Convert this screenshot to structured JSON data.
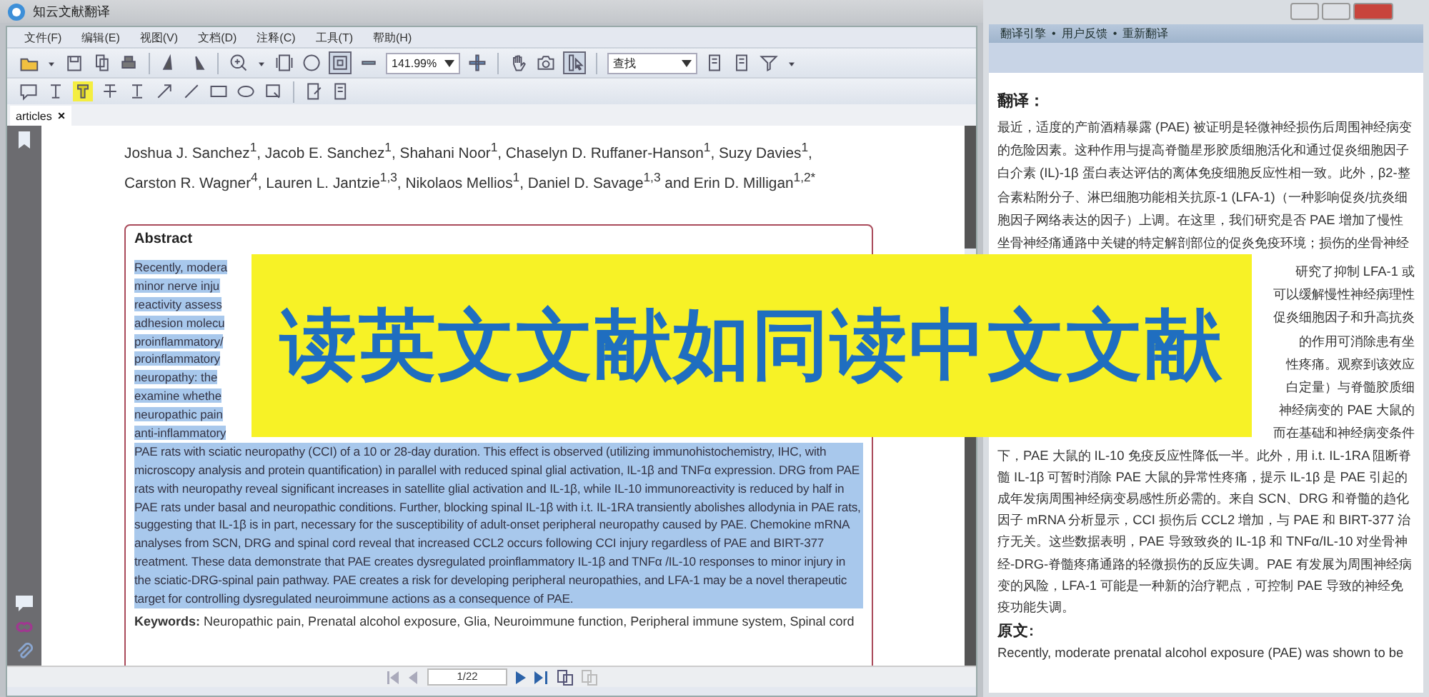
{
  "window": {
    "title": "知云文献翻译"
  },
  "menu": [
    "文件(F)",
    "编辑(E)",
    "视图(V)",
    "文档(D)",
    "注释(C)",
    "工具(T)",
    "帮助(H)"
  ],
  "toolbar": {
    "zoom": "141.99%",
    "search_mode": "查找"
  },
  "tabs": [
    {
      "label": "articles",
      "close": "×",
      "selected": true
    }
  ],
  "document": {
    "authors": [
      "Joshua J. Sanchez$^{1}$, Jacob E. Sanchez$^{1}$, Shahani Noor$^{1}$, Chaselyn D. Ruffaner-Hanson$^{1}$, Suzy Davies$^{1}$,",
      "Carston R. Wagner$^{4}$, Lauren L. Jantzie$^{1,3}$, Nikolaos Mellios$^{1}$, Daniel D. Savage$^{1,3}$ and Erin D. Milligan$^{1,2*}$"
    ],
    "abstract_title": "Abstract",
    "abstract": {
      "selected": true,
      "visible_line_starts": [
        "Recently, modera",
        "minor nerve inju",
        "reactivity assess",
        "adhesion molecu",
        "proinflammatory/",
        "proinflammatory",
        "neuropathy: the",
        "examine whethe",
        "neuropathic pain",
        "anti-inflammatory"
      ],
      "text": "PAE rats with sciatic neuropathy (CCI) of a 10 or 28-day duration. This effect is observed (utilizing immunohistochemistry, IHC, with microscopy analysis and protein quantification) in parallel with reduced spinal glial activation, IL-1β and TNFα expression. DRG from PAE rats with neuropathy reveal significant increases in satellite glial activation and IL-1β, while IL-10 immunoreactivity is reduced by half in PAE rats under basal and neuropathic conditions. Further, blocking spinal IL-1β with i.t. IL-1RA transiently abolishes allodynia in PAE rats, suggesting that IL-1β is in part, necessary for the susceptibility of adult-onset peripheral neuropathy caused by PAE. Chemokine mRNA analyses from SCN, DRG and spinal cord reveal that increased CCL2 occurs following CCI injury regardless of PAE and BIRT-377 treatment. These data demonstrate that PAE creates dysregulated proinflammatory IL-1β and TNFα /IL-10 responses to minor injury in the sciatic-DRG-spinal pain pathway. PAE creates a risk for developing peripheral neuropathies, and LFA-1 may be a novel therapeutic target for controlling dysregulated neuroimmune actions as a consequence of PAE."
    },
    "keywords": "**Keywords:** Neuropathic pain, Prenatal alcohol exposure, Glia, Neuroimmune function, Peripheral immune system, Spinal cord"
  },
  "page_nav": {
    "page": "1/22"
  },
  "banner": {
    "text": "读英文文献如同读中文文献"
  },
  "translation_panel": {
    "links": [
      "翻译引擎",
      "用户反馈",
      "重新翻译"
    ],
    "separator": "•",
    "heading": "翻译：",
    "translation_top": "最近，适度的产前酒精暴露 (PAE) 被证明是轻微神经损伤后周围神经病变的危险因素。这种作用与提高脊髓星形胶质细胞活化和通过促炎细胞因子白介素 (IL)-1β 蛋白表达评估的离体免疫细胞反应性相一致。此外，β2-整合素粘附分子、淋巴细胞功能相关抗原-1 (LFA-1)（一种影响促炎/抗炎细胞因子网络表达的因子）上调。在这里，我们研究是否 PAE 增加了慢性坐骨神经痛通路中关键的特定解剖部位的促炎免疫环境；损伤的坐骨神经",
    "visible_line_ends": [
      "研究了抑制 LFA-1 或",
      "可以缓解慢性神经病理性",
      "促炎细胞因子和升高抗炎",
      "的作用可消除患有坐",
      "性疼痛。观察到该效应",
      "白定量）与脊髓胶质细",
      "神经病变的 PAE 大鼠的",
      "而在基础和神经病变条件"
    ],
    "translation_bottom": "下，PAE 大鼠的 IL-10 免疫反应性降低一半。此外，用 i.t. IL-1RA 阻断脊髓 IL-1β 可暂时消除 PAE 大鼠的异常性疼痛，提示 IL-1β 是 PAE 引起的成年发病周围神经病变易感性所必需的。来自 SCN、DRG 和脊髓的趋化因子 mRNA 分析显示，CCI 损伤后 CCL2 增加，与 PAE 和 BIRT-377 治疗无关。这些数据表明，PAE 导致致炎的 IL-1β 和 TNFα/IL-10 对坐骨神经-DRG-脊髓疼痛通路的轻微损伤的反应失调。PAE 有发展为周围神经病变的风险，LFA-1 可能是一种新的治疗靶点，可控制 PAE 导致的神经免疫功能失调。",
    "original_heading": "原文:",
    "original": "Recently, moderate prenatal alcohol exposure (PAE) was shown to be"
  }
}
